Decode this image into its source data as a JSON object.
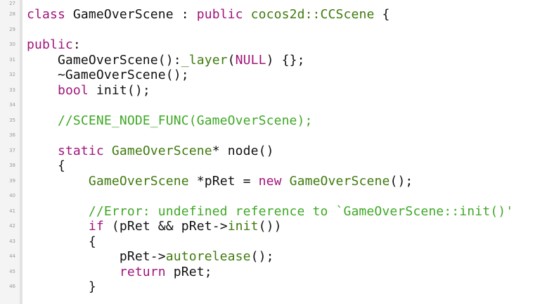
{
  "colors": {
    "default": "#111111",
    "keyword": "#a0157a",
    "type": "#3f7a0d",
    "comment": "#3ea825",
    "gutter_bg": "#f4f4f4",
    "line_number": "#9a9a9a"
  },
  "lines": [
    {
      "number": "27",
      "tokens": []
    },
    {
      "number": "28",
      "tokens": [
        {
          "text": "class ",
          "kind": "keyword"
        },
        {
          "text": "GameOverScene",
          "kind": "default"
        },
        {
          "text": " : ",
          "kind": "default"
        },
        {
          "text": "public",
          "kind": "keyword"
        },
        {
          "text": " ",
          "kind": "default"
        },
        {
          "text": "cocos2d::CCScene",
          "kind": "type"
        },
        {
          "text": " {",
          "kind": "default"
        }
      ]
    },
    {
      "number": "29",
      "tokens": []
    },
    {
      "number": "30",
      "tokens": [
        {
          "text": "public",
          "kind": "keyword"
        },
        {
          "text": ":",
          "kind": "default"
        }
      ]
    },
    {
      "number": "31",
      "tokens": [
        {
          "text": "    GameOverScene():",
          "kind": "default"
        },
        {
          "text": "_layer",
          "kind": "type"
        },
        {
          "text": "(",
          "kind": "default"
        },
        {
          "text": "NULL",
          "kind": "keyword"
        },
        {
          "text": ") {};",
          "kind": "default"
        }
      ]
    },
    {
      "number": "32",
      "tokens": [
        {
          "text": "    ~GameOverScene();",
          "kind": "default"
        }
      ]
    },
    {
      "number": "33",
      "tokens": [
        {
          "text": "    ",
          "kind": "default"
        },
        {
          "text": "bool",
          "kind": "keyword"
        },
        {
          "text": " init();",
          "kind": "default"
        }
      ]
    },
    {
      "number": "34",
      "tokens": []
    },
    {
      "number": "35",
      "tokens": [
        {
          "text": "    //SCENE_NODE_FUNC(GameOverScene);",
          "kind": "comment"
        }
      ]
    },
    {
      "number": "36",
      "tokens": []
    },
    {
      "number": "37",
      "tokens": [
        {
          "text": "    ",
          "kind": "default"
        },
        {
          "text": "static",
          "kind": "keyword"
        },
        {
          "text": " ",
          "kind": "default"
        },
        {
          "text": "GameOverScene",
          "kind": "type"
        },
        {
          "text": "* node()",
          "kind": "default"
        }
      ]
    },
    {
      "number": "38",
      "tokens": [
        {
          "text": "    {",
          "kind": "default"
        }
      ]
    },
    {
      "number": "39",
      "tokens": [
        {
          "text": "        ",
          "kind": "default"
        },
        {
          "text": "GameOverScene",
          "kind": "type"
        },
        {
          "text": " *pRet = ",
          "kind": "default"
        },
        {
          "text": "new",
          "kind": "keyword"
        },
        {
          "text": " ",
          "kind": "default"
        },
        {
          "text": "GameOverScene",
          "kind": "type"
        },
        {
          "text": "();",
          "kind": "default"
        }
      ]
    },
    {
      "number": "40",
      "tokens": []
    },
    {
      "number": "41",
      "tokens": [
        {
          "text": "        //Error: undefined reference to `GameOverScene::init()'",
          "kind": "comment"
        }
      ]
    },
    {
      "number": "42",
      "tokens": [
        {
          "text": "        ",
          "kind": "default"
        },
        {
          "text": "if",
          "kind": "keyword"
        },
        {
          "text": " (pRet && pRet->",
          "kind": "default"
        },
        {
          "text": "init",
          "kind": "type"
        },
        {
          "text": "())",
          "kind": "default"
        }
      ]
    },
    {
      "number": "43",
      "tokens": [
        {
          "text": "        {",
          "kind": "default"
        }
      ]
    },
    {
      "number": "44",
      "tokens": [
        {
          "text": "            pRet->",
          "kind": "default"
        },
        {
          "text": "autorelease",
          "kind": "type"
        },
        {
          "text": "();",
          "kind": "default"
        }
      ]
    },
    {
      "number": "45",
      "tokens": [
        {
          "text": "            ",
          "kind": "default"
        },
        {
          "text": "return",
          "kind": "keyword"
        },
        {
          "text": " pRet;",
          "kind": "default"
        }
      ]
    },
    {
      "number": "46",
      "tokens": [
        {
          "text": "        }",
          "kind": "default"
        }
      ]
    }
  ]
}
